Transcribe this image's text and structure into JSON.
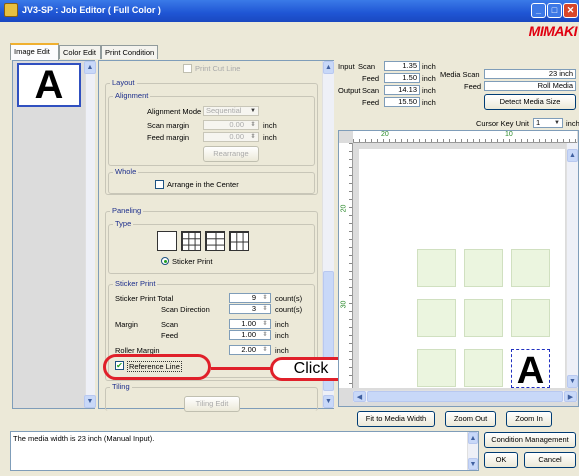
{
  "window": {
    "title": "JV3-SP : Job Editor ( Full Color )",
    "brand": "MIMAKI"
  },
  "tabs": [
    {
      "label": "Image Edit"
    },
    {
      "label": "Color Edit"
    },
    {
      "label": "Print Condition"
    }
  ],
  "thumbnail": {
    "letter": "A"
  },
  "settings": {
    "print_cut_line": "Print Cut Line",
    "layout": {
      "title": "Layout",
      "alignment_title": "Alignment",
      "alignment_mode_label": "Alignment Mode",
      "alignment_mode_value": "Sequential",
      "scan_margin_label": "Scan margin",
      "scan_margin_value": "0.00",
      "feed_margin_label": "Feed margin",
      "feed_margin_value": "0.00",
      "unit": "inch",
      "rearrange": "Rearrange"
    },
    "whole": {
      "title": "Whole",
      "arrange_center": "Arrange in the Center"
    },
    "paneling": {
      "title": "Paneling",
      "type_title": "Type",
      "sticker_print": "Sticker Print"
    },
    "sticker": {
      "title": "Sticker Print",
      "total_label": "Sticker Print Total",
      "total_value": "9",
      "direction_label": "Scan Direction",
      "direction_value": "3",
      "count_unit": "count(s)",
      "margin_label": "Margin",
      "scan_label": "Scan",
      "scan_value": "1.00",
      "feed_label": "Feed",
      "feed_value": "1.00",
      "roller_label": "Roller Margin",
      "roller_value": "2.00",
      "unit": "inch",
      "reference_line": "Reference Line"
    },
    "tiling": {
      "title": "Tiling",
      "tiling_edit": "Tiling Edit"
    }
  },
  "callout": {
    "label": "Click"
  },
  "info": {
    "input_label": "Input",
    "output_label": "Output",
    "scan_label": "Scan",
    "feed_label": "Feed",
    "input_scan": "1.35",
    "input_feed": "1.50",
    "output_scan": "14.13",
    "output_feed": "15.50",
    "unit": "inch",
    "media_scan_label": "Media Scan",
    "media_scan_value": "23 inch",
    "media_feed_label": "Feed",
    "media_feed_value": "Roll Media",
    "detect_media_size": "Detect Media Size",
    "cursor_key_unit_label": "Cursor Key Unit",
    "cursor_key_unit_value": "1",
    "cursor_unit": "inch"
  },
  "ruler": {
    "h_ticks": [
      "20",
      "10"
    ],
    "v_ticks": [
      "20",
      "30"
    ]
  },
  "preview": {
    "letter": "A"
  },
  "bottom_buttons": {
    "fit": "Fit to Media Width",
    "zoom_out": "Zoom Out",
    "zoom_in": "Zoom In"
  },
  "status": {
    "message": "The media width is 23 inch (Manual Input).",
    "condition_management": "Condition Management",
    "ok": "OK",
    "cancel": "Cancel"
  }
}
